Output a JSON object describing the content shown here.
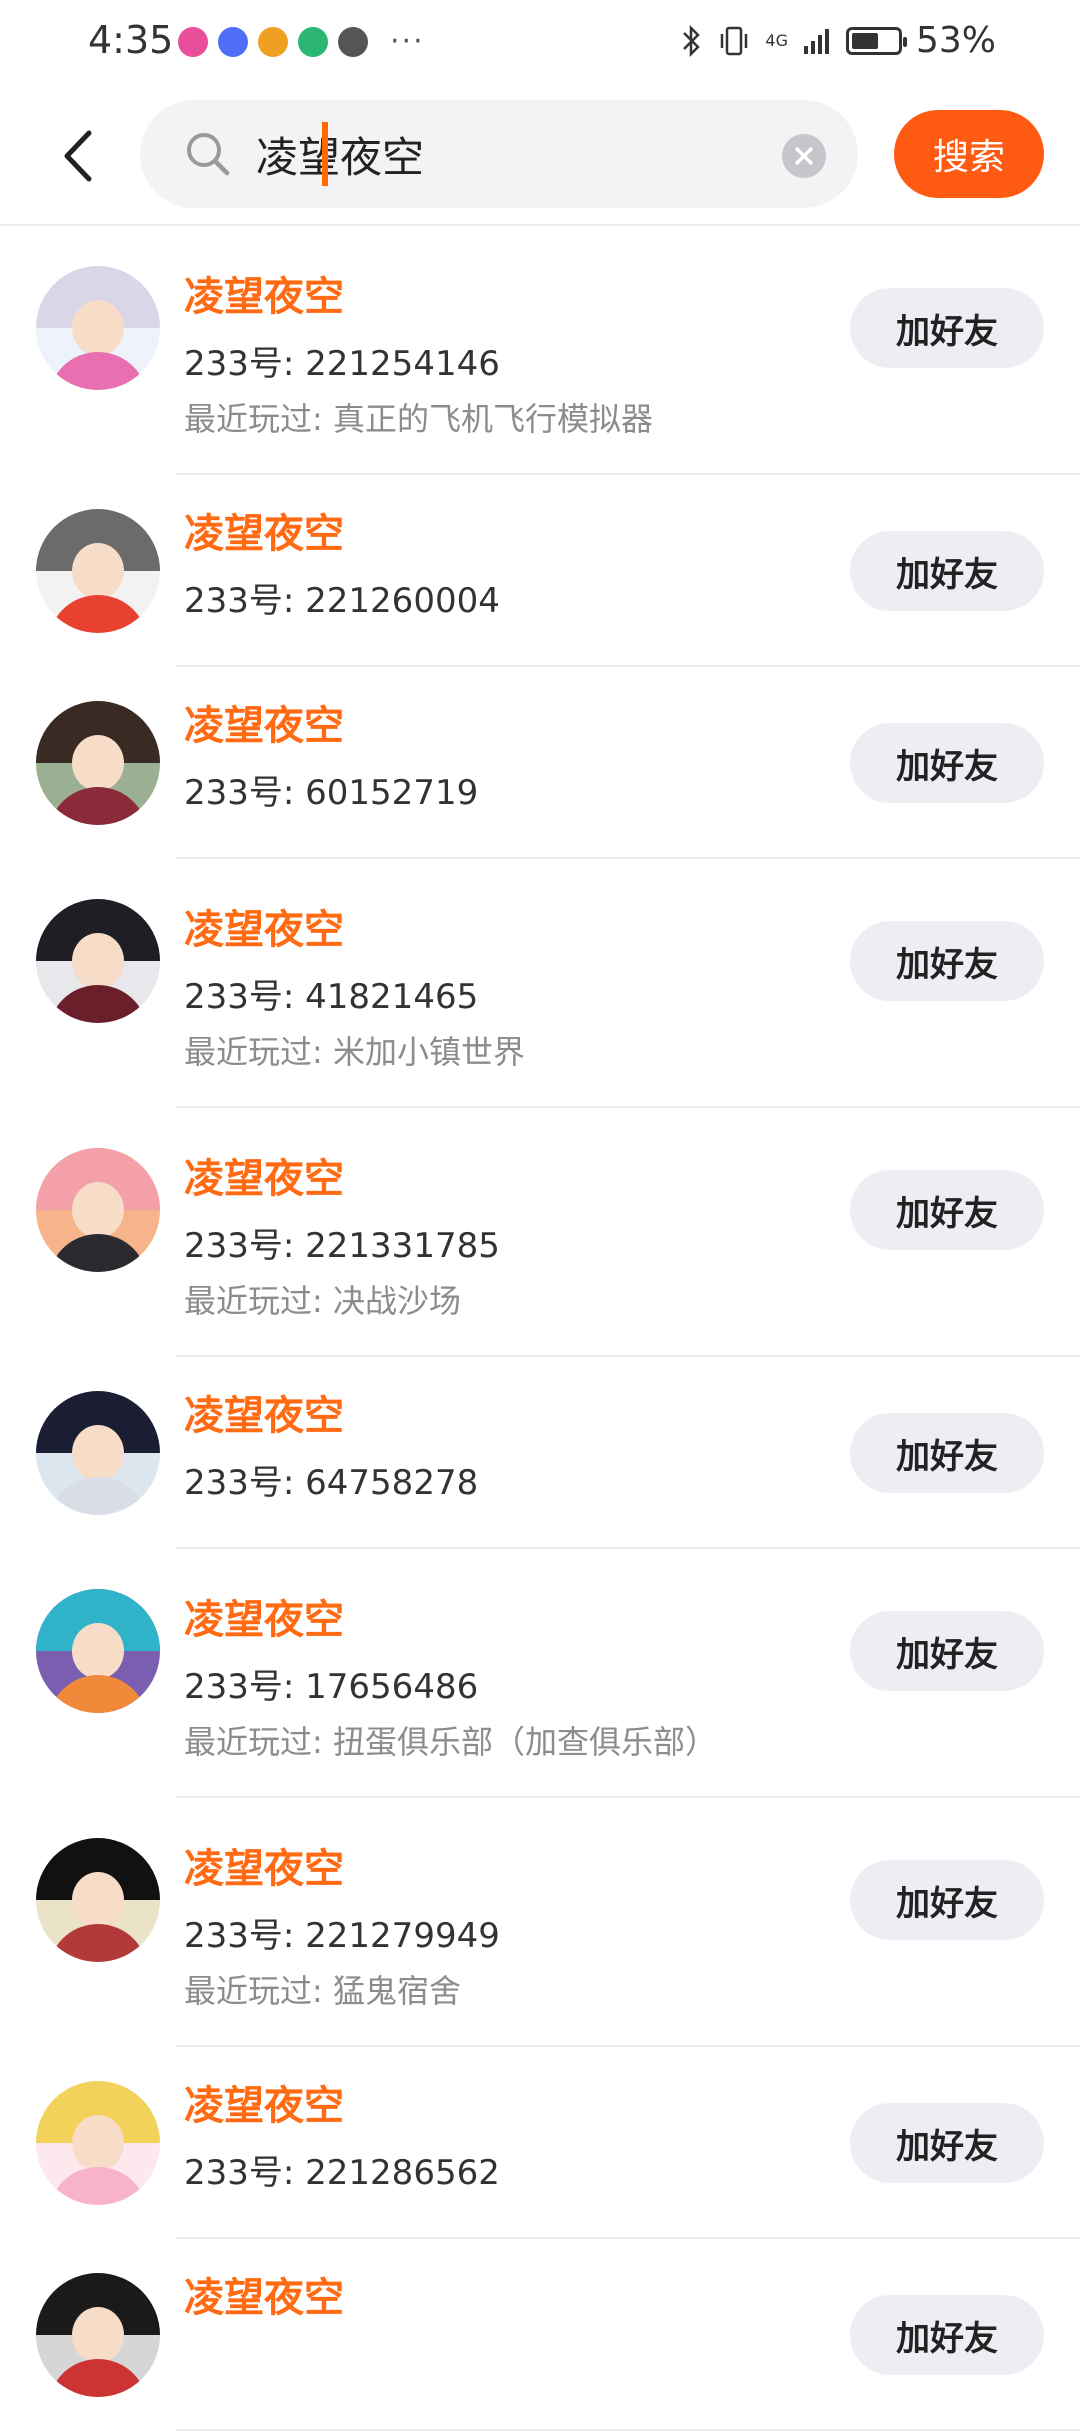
{
  "status_bar": {
    "time": "4:35",
    "more": "···",
    "network": "4G",
    "battery_percent": "53%",
    "battery_level": 0.53,
    "app_icon_colors": [
      "#e94e9b",
      "#4f6ef7",
      "#f0a020",
      "#2bb673",
      "#555555"
    ]
  },
  "search": {
    "back_icon": "back-arrow-icon",
    "query": "凌望夜空",
    "search_button_label": "搜索",
    "accent_color": "#ff5a12"
  },
  "results": [
    {
      "name": "凌望夜空",
      "id_label": "233号: 221254146",
      "recent": "最近玩过: 真正的飞机飞行模拟器",
      "button": "加好友",
      "hair": "#d9d6e8",
      "body": "#e86fb0",
      "bg": "#eef2fb"
    },
    {
      "name": "凌望夜空",
      "id_label": "233号: 221260004",
      "recent": "",
      "button": "加好友",
      "hair": "#6b6b6b",
      "body": "#e8412f",
      "bg": "#f2f2f2"
    },
    {
      "name": "凌望夜空",
      "id_label": "233号: 60152719",
      "recent": "",
      "button": "加好友",
      "hair": "#3a2a24",
      "body": "#8b2b3a",
      "bg": "#9bb092"
    },
    {
      "name": "凌望夜空",
      "id_label": "233号: 41821465",
      "recent": "最近玩过: 米加小镇世界",
      "button": "加好友",
      "hair": "#1e1e24",
      "body": "#6b1f2a",
      "bg": "#e8e8ec"
    },
    {
      "name": "凌望夜空",
      "id_label": "233号: 221331785",
      "recent": "最近玩过: 决战沙场",
      "button": "加好友",
      "hair": "#f4a0a8",
      "body": "#2a2a30",
      "bg": "#f7b48a"
    },
    {
      "name": "凌望夜空",
      "id_label": "233号: 64758278",
      "recent": "",
      "button": "加好友",
      "hair": "#1b1d33",
      "body": "#d9dde6",
      "bg": "#dbe6ef"
    },
    {
      "name": "凌望夜空",
      "id_label": "233号: 17656486",
      "recent": "最近玩过: 扭蛋俱乐部（加查俱乐部）",
      "button": "加好友",
      "hair": "#2fb3c9",
      "body": "#f08a3a",
      "bg": "#7a5fb0"
    },
    {
      "name": "凌望夜空",
      "id_label": "233号: 221279949",
      "recent": "最近玩过: 猛鬼宿舍",
      "button": "加好友",
      "hair": "#111111",
      "body": "#b23a3a",
      "bg": "#eae3c8"
    },
    {
      "name": "凌望夜空",
      "id_label": "233号: 221286562",
      "recent": "",
      "button": "加好友",
      "hair": "#f2d25a",
      "body": "#f7b3c8",
      "bg": "#fde8ee"
    },
    {
      "name": "凌望夜空",
      "id_label": "",
      "recent": "",
      "button": "加好友",
      "hair": "#1a1a1a",
      "body": "#cc3333",
      "bg": "#d6d6d6"
    }
  ]
}
